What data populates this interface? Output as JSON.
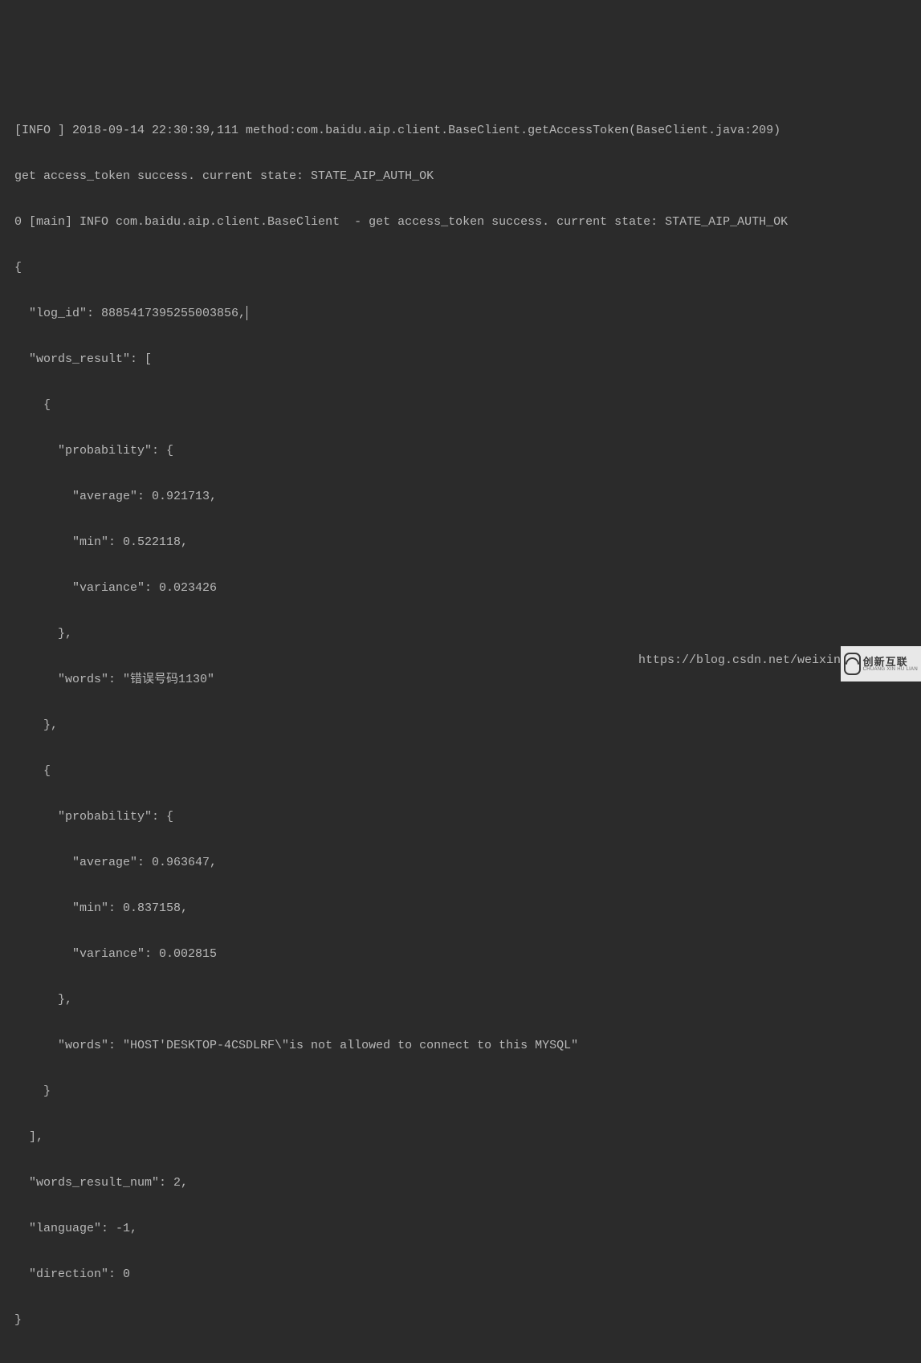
{
  "console": {
    "lines": [
      "[INFO ] 2018-09-14 22:30:39,111 method:com.baidu.aip.client.BaseClient.getAccessToken(BaseClient.java:209)",
      "get access_token success. current state: STATE_AIP_AUTH_OK",
      "0 [main] INFO com.baidu.aip.client.BaseClient  - get access_token success. current state: STATE_AIP_AUTH_OK",
      "{",
      "  \"log_id\": 8885417395255003856,",
      "  \"words_result\": [",
      "    {",
      "      \"probability\": {",
      "        \"average\": 0.921713,",
      "        \"min\": 0.522118,",
      "        \"variance\": 0.023426",
      "      },",
      "      \"words\": \"错误号码1130\"",
      "    },",
      "    {",
      "      \"probability\": {",
      "        \"average\": 0.963647,",
      "        \"min\": 0.837158,",
      "        \"variance\": 0.002815",
      "      },",
      "      \"words\": \"HOST'DESKTOP-4CSDLRF\\\"is not allowed to connect to this MYSQL\"",
      "    }",
      "  ],",
      "  \"words_result_num\": 2,",
      "  \"language\": -1,",
      "  \"direction\": 0",
      "}"
    ]
  },
  "footer": {
    "url": "https://blog.csdn.net/weixin"
  },
  "watermark": {
    "cn": "创新互联",
    "en": "CHUANG XIN HU LIAN"
  }
}
